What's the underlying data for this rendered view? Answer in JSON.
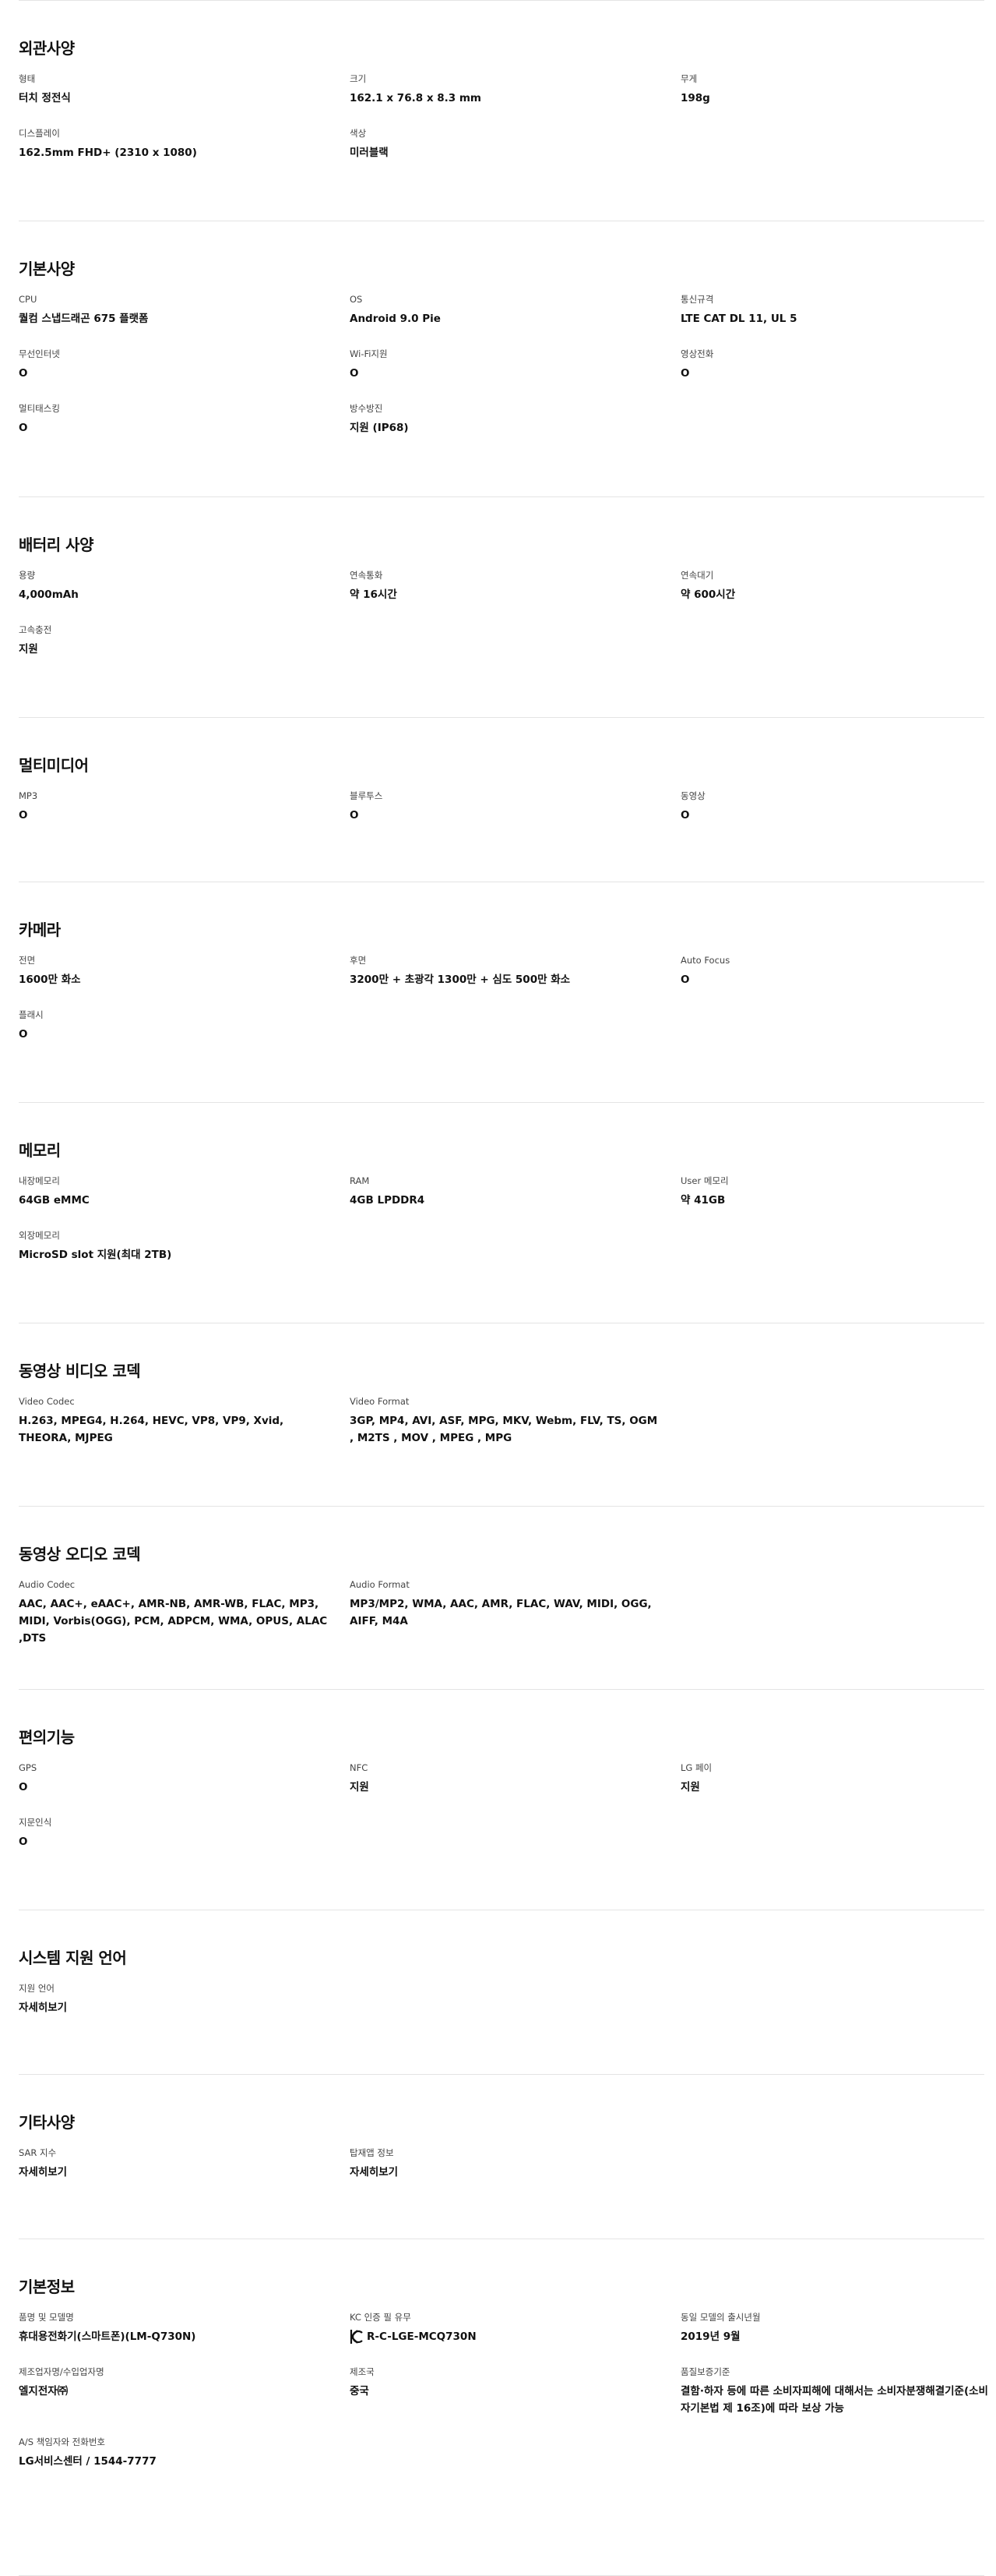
{
  "sections": [
    {
      "title": "외관사양",
      "items": [
        {
          "label": "형태",
          "value": "터치 정전식"
        },
        {
          "label": "크기",
          "value": "162.1 x 76.8 x 8.3 mm"
        },
        {
          "label": "무게",
          "value": "198g"
        },
        {
          "label": "디스플레이",
          "value": "162.5mm FHD+ (2310 x 1080)"
        },
        {
          "label": "색상",
          "value": "미러블랙"
        }
      ]
    },
    {
      "title": "기본사양",
      "items": [
        {
          "label": "CPU",
          "value": "퀄컴 스냅드래곤 675 플랫폼"
        },
        {
          "label": "OS",
          "value": "Android 9.0 Pie"
        },
        {
          "label": "통신규격",
          "value": "LTE CAT DL 11, UL 5"
        },
        {
          "label": "무선인터넷",
          "value": "O"
        },
        {
          "label": "Wi-Fi지원",
          "value": "O"
        },
        {
          "label": "영상전화",
          "value": "O"
        },
        {
          "label": "멀티태스킹",
          "value": "O"
        },
        {
          "label": "방수방진",
          "value": "지원 (IP68)"
        }
      ]
    },
    {
      "title": "배터리 사양",
      "items": [
        {
          "label": "용량",
          "value": "4,000mAh"
        },
        {
          "label": "연속통화",
          "value": "약 16시간"
        },
        {
          "label": "연속대기",
          "value": "약 600시간"
        },
        {
          "label": "고속충전",
          "value": "지원"
        }
      ]
    },
    {
      "title": "멀티미디어",
      "items": [
        {
          "label": "MP3",
          "value": "O"
        },
        {
          "label": "블루투스",
          "value": "O"
        },
        {
          "label": "동영상",
          "value": "O"
        }
      ]
    },
    {
      "title": "카메라",
      "items": [
        {
          "label": "전면",
          "value": "1600만 화소"
        },
        {
          "label": "후면",
          "value": "3200만 + 초광각 1300만 + 심도 500만 화소"
        },
        {
          "label": "Auto Focus",
          "value": "O"
        },
        {
          "label": "플래시",
          "value": "O"
        }
      ]
    },
    {
      "title": "메모리",
      "items": [
        {
          "label": "내장메모리",
          "value": "64GB eMMC"
        },
        {
          "label": "RAM",
          "value": "4GB LPDDR4"
        },
        {
          "label": "User 메모리",
          "value": "약 41GB"
        },
        {
          "label": "외장메모리",
          "value": "MicroSD slot 지원(최대 2TB)"
        }
      ]
    },
    {
      "title": "동영상 비디오 코덱",
      "items": [
        {
          "label": "Video Codec",
          "value": "H.263, MPEG4, H.264, HEVC, VP8, VP9, Xvid, THEORA, MJPEG"
        },
        {
          "label": "Video Format",
          "value": "3GP, MP4, AVI, ASF, MPG, MKV, Webm, FLV, TS, OGM , M2TS , MOV , MPEG , MPG"
        }
      ]
    },
    {
      "title": "동영상 오디오 코덱",
      "items": [
        {
          "label": "Audio Codec",
          "value": "AAC, AAC+, eAAC+, AMR-NB, AMR-WB, FLAC, MP3, MIDI, Vorbis(OGG), PCM, ADPCM, WMA, OPUS, ALAC ,DTS"
        },
        {
          "label": "Audio Format",
          "value": "MP3/MP2, WMA, AAC, AMR, FLAC, WAV, MIDI, OGG, AIFF, M4A"
        }
      ]
    },
    {
      "title": "편의기능",
      "items": [
        {
          "label": "GPS",
          "value": "O"
        },
        {
          "label": "NFC",
          "value": "지원"
        },
        {
          "label": "LG 페이",
          "value": "지원"
        },
        {
          "label": "지문인식",
          "value": "O"
        }
      ]
    },
    {
      "title": "시스템 지원 언어",
      "items": [
        {
          "label": "지원 언어",
          "value": "자세히보기",
          "link": true
        }
      ]
    },
    {
      "title": "기타사양",
      "items": [
        {
          "label": "SAR 지수",
          "value": "자세히보기",
          "link": true
        },
        {
          "label": "탑재앱 정보",
          "value": "자세히보기",
          "link": true
        }
      ]
    },
    {
      "title": "기본정보",
      "items": [
        {
          "label": "품명 및 모델명",
          "value": "휴대용전화기(스마트폰)(LM-Q730N)"
        },
        {
          "label": "KC 인증 필 유무",
          "value": "R-C-LGE-MCQ730N",
          "kc": true
        },
        {
          "label": "동일 모델의 출시년월",
          "value": "2019년 9월"
        },
        {
          "label": "제조업자명/수입업자명",
          "value": "엘지전자㈜"
        },
        {
          "label": "제조국",
          "value": "중국"
        },
        {
          "label": "품질보증기준",
          "value": "결함·하자 등에 따른 소비자피해에 대해서는 소비자분쟁해결기준(소비자기본법 제 16조)에 따라 보상 가능"
        },
        {
          "label": "A/S 책임자와 전화번호",
          "value": "LG서비스센터 / 1544-7777"
        }
      ]
    }
  ]
}
